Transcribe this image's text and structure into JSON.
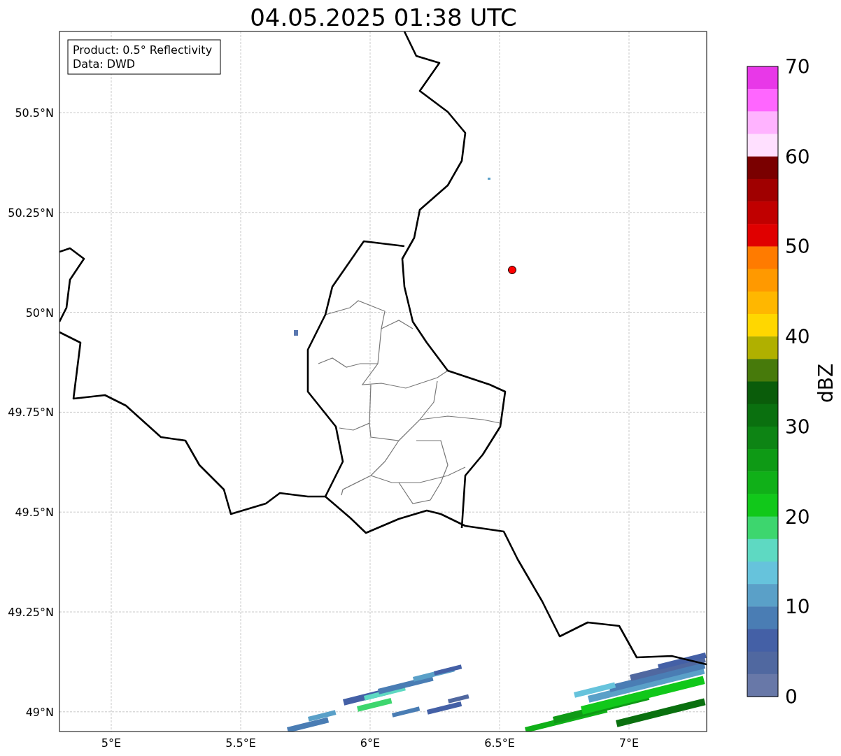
{
  "title": "04.05.2025 01:38 UTC",
  "map": {
    "info_lines": [
      "Product: 0.5° Reflectivity",
      "Data: DWD"
    ],
    "lat_ticks": [
      "50.5°N",
      "50.25°N",
      "50°N",
      "49.75°N",
      "49.5°N",
      "49.25°N",
      "49°N"
    ],
    "lon_ticks": [
      "5°E",
      "5.5°E",
      "6°E",
      "6.5°E",
      "7°E"
    ]
  },
  "colorbar": {
    "label": "dBZ",
    "ticks": [
      "70",
      "60",
      "50",
      "40",
      "30",
      "20",
      "10",
      "0"
    ],
    "bands": [
      {
        "color": "#e838e8"
      },
      {
        "color": "#ff66ff"
      },
      {
        "color": "#ffb3ff"
      },
      {
        "color": "#ffe0ff"
      },
      {
        "color": "#7a0000"
      },
      {
        "color": "#a00000"
      },
      {
        "color": "#c00000"
      },
      {
        "color": "#e00000"
      },
      {
        "color": "#ff7b00"
      },
      {
        "color": "#ff9900"
      },
      {
        "color": "#ffb700"
      },
      {
        "color": "#ffd700"
      },
      {
        "color": "#b0b000"
      },
      {
        "color": "#477a0b"
      },
      {
        "color": "#0a5c0a"
      },
      {
        "color": "#0a700f"
      },
      {
        "color": "#0d8414"
      },
      {
        "color": "#0e9a15"
      },
      {
        "color": "#10b018"
      },
      {
        "color": "#11c81a"
      },
      {
        "color": "#3dd66e"
      },
      {
        "color": "#5ed9c2"
      },
      {
        "color": "#66c3dc"
      },
      {
        "color": "#5aa0c8"
      },
      {
        "color": "#4a7db4"
      },
      {
        "color": "#4460a6"
      },
      {
        "color": "#5068a0"
      },
      {
        "color": "#6878a8"
      }
    ]
  }
}
